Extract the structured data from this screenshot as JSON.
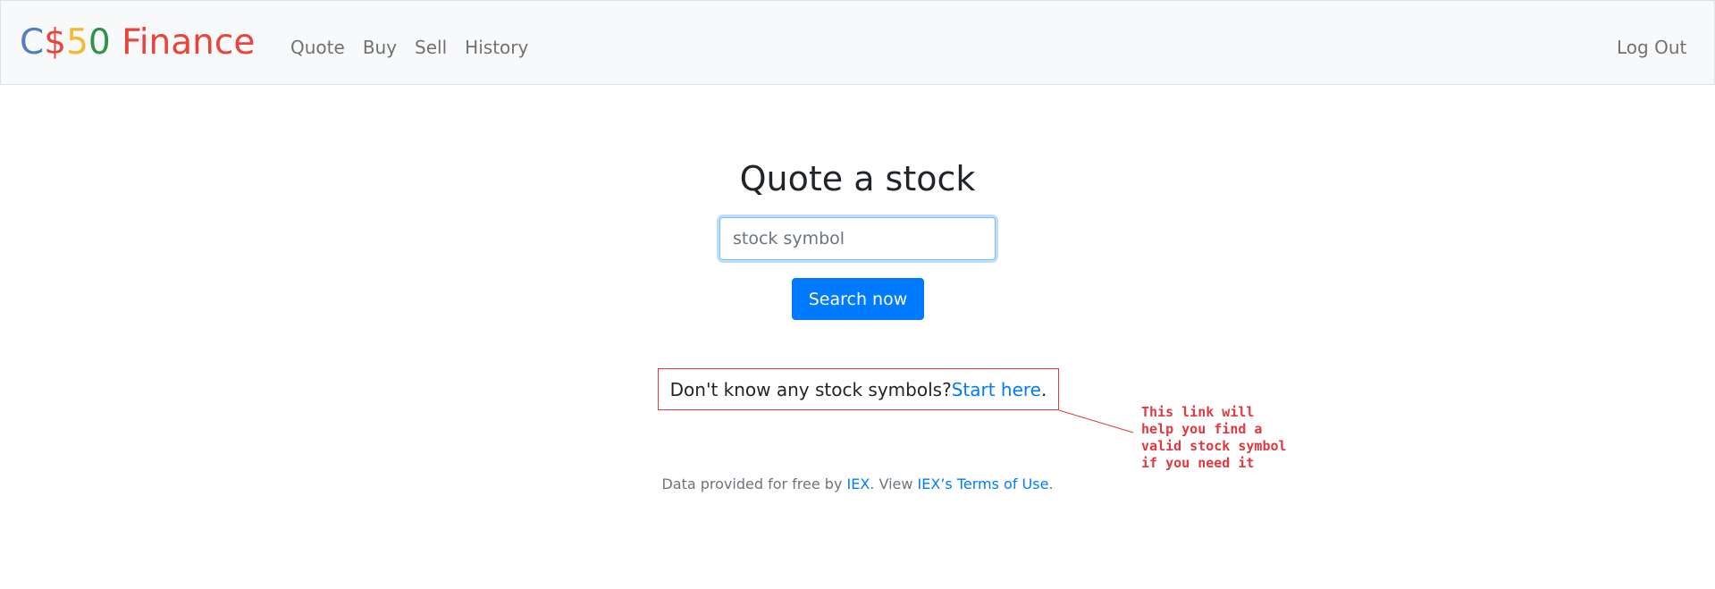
{
  "navbar": {
    "brand": {
      "c": "C",
      "dollar": "$",
      "five": "5",
      "zero": "0",
      "word": " Finance"
    },
    "links": [
      "Quote",
      "Buy",
      "Sell",
      "History"
    ],
    "logout": "Log Out"
  },
  "main": {
    "title": "Quote a stock",
    "search_placeholder": "stock symbol",
    "search_value": "",
    "search_button": "Search now",
    "hint_text": "Don't know any stock symbols? ",
    "hint_link": "Start here",
    "hint_end": "."
  },
  "annotation": {
    "note": "This link will\nhelp you find a\nvalid stock symbol\nif you need it"
  },
  "footer": {
    "prefix": "Data provided for free by ",
    "iex_link": "IEX",
    "middle": ". View ",
    "terms_link": "IEX’s Terms of Use",
    "suffix": "."
  },
  "colors": {
    "brand_blue": "#537fbe",
    "brand_red": "#ea433b",
    "brand_yellow": "#f5b82e",
    "brand_green": "#2e944b",
    "primary": "#007bff",
    "annotation_red": "#e0383e"
  }
}
